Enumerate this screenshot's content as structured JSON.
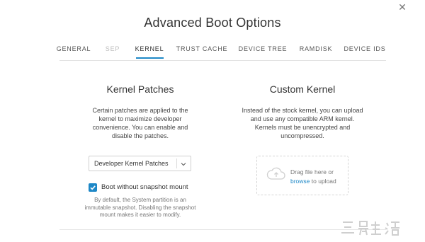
{
  "dialog": {
    "title": "Advanced Boot Options",
    "close_icon": "close-icon"
  },
  "tabs": [
    {
      "label": "GENERAL",
      "state": "normal"
    },
    {
      "label": "SEP",
      "state": "disabled"
    },
    {
      "label": "KERNEL",
      "state": "active"
    },
    {
      "label": "TRUST CACHE",
      "state": "normal"
    },
    {
      "label": "DEVICE TREE",
      "state": "normal"
    },
    {
      "label": "RAMDISK",
      "state": "normal"
    },
    {
      "label": "DEVICE IDS",
      "state": "normal"
    }
  ],
  "kernel_patches": {
    "title": "Kernel Patches",
    "description": "Certain patches are applied to the kernel to maximize developer convenience. You can enable and disable the patches.",
    "select_value": "Developer Kernel Patches",
    "checkbox_label": "Boot without snapshot mount",
    "checkbox_checked": true,
    "note": "By default, the System partition is an immutable snapshot. Disabling the snapshot mount makes it easier to modify."
  },
  "custom_kernel": {
    "title": "Custom Kernel",
    "description": "Instead of the stock kernel, you can upload and use any compatible ARM kernel. Kernels must be unencrypted and uncompressed.",
    "dropzone_line1": "Drag file here or",
    "dropzone_link": "browse",
    "dropzone_line2_rest": "to upload"
  },
  "colors": {
    "accent": "#1e88c7",
    "text": "#333333",
    "muted": "#777777"
  }
}
